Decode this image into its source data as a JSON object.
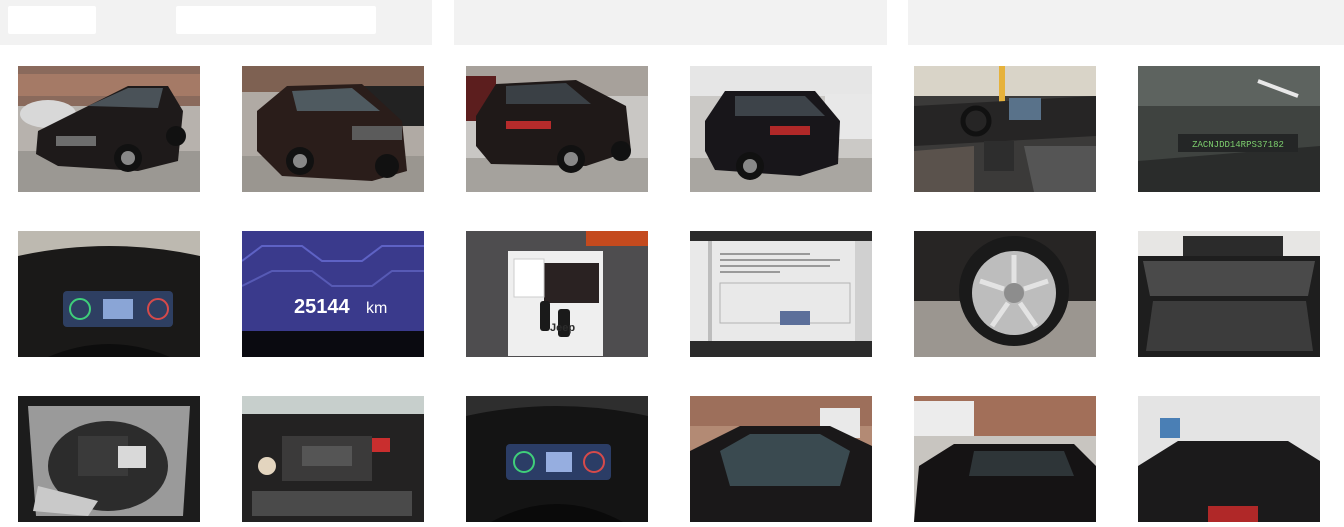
{
  "columns": [
    {
      "name": "column-1"
    },
    {
      "name": "column-2"
    },
    {
      "name": "column-3"
    }
  ],
  "gallery": {
    "odometer": {
      "value": "25144",
      "unit": "km"
    },
    "manual_cover_text": "Jeep",
    "vin_sticker": "ZACNJDD14RPS37182",
    "photos": [
      {
        "name": "photo-front-left-exterior",
        "icon": "car-front-left-icon"
      },
      {
        "name": "photo-front-right-exterior",
        "icon": "car-front-right-icon"
      },
      {
        "name": "photo-rear-left-exterior",
        "icon": "car-rear-left-icon"
      },
      {
        "name": "photo-rear-right-exterior",
        "icon": "car-rear-right-icon"
      },
      {
        "name": "photo-interior-dashboard",
        "icon": "dashboard-icon"
      },
      {
        "name": "photo-windshield-vin",
        "icon": "vin-plate-icon"
      },
      {
        "name": "photo-instrument-cluster",
        "icon": "instrument-cluster-icon"
      },
      {
        "name": "photo-odometer",
        "icon": "odometer-icon"
      },
      {
        "name": "photo-keys-and-manual",
        "icon": "car-keys-icon"
      },
      {
        "name": "photo-service-book",
        "icon": "service-book-icon"
      },
      {
        "name": "photo-wheel",
        "icon": "wheel-icon"
      },
      {
        "name": "photo-trunk",
        "icon": "trunk-icon"
      },
      {
        "name": "photo-spare-wheel-well",
        "icon": "spare-wheel-icon"
      },
      {
        "name": "photo-engine-bay",
        "icon": "engine-icon"
      },
      {
        "name": "photo-instrument-cluster-2",
        "icon": "instrument-cluster-icon"
      },
      {
        "name": "photo-roof-windshield",
        "icon": "roof-icon"
      },
      {
        "name": "photo-roof-top",
        "icon": "roof-icon"
      },
      {
        "name": "photo-rear-roof",
        "icon": "roof-icon"
      }
    ]
  }
}
